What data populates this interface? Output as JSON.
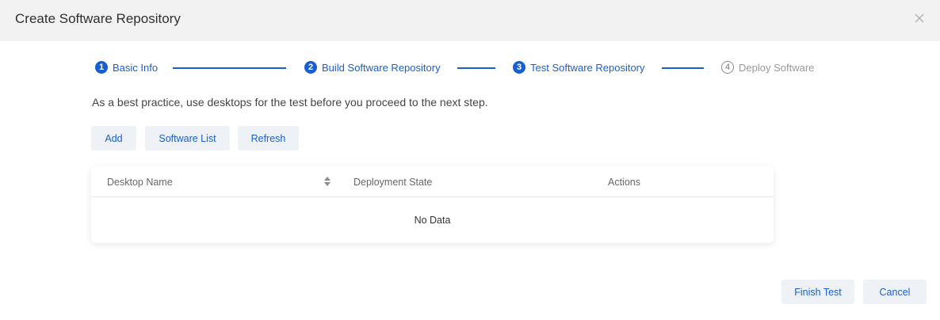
{
  "dialog": {
    "title": "Create Software Repository"
  },
  "steps": [
    {
      "number": "1",
      "label": "Basic Info",
      "state": "active"
    },
    {
      "number": "2",
      "label": "Build Software Repository",
      "state": "active"
    },
    {
      "number": "3",
      "label": "Test Software Repository",
      "state": "active"
    },
    {
      "number": "4",
      "label": "Deploy Software",
      "state": "pending"
    }
  ],
  "hint": "As a best practice, use desktops for the test before you proceed to the next step.",
  "toolbar": {
    "add_label": "Add",
    "software_list_label": "Software List",
    "refresh_label": "Refresh"
  },
  "table": {
    "columns": [
      "Desktop Name",
      "Deployment State",
      "Actions"
    ],
    "empty_text": "No Data"
  },
  "footer": {
    "finish_label": "Finish Test",
    "cancel_label": "Cancel"
  },
  "colors": {
    "accent": "#1a5fd0",
    "header_bg": "#f2f2f2",
    "button_bg": "#eef1f5"
  }
}
